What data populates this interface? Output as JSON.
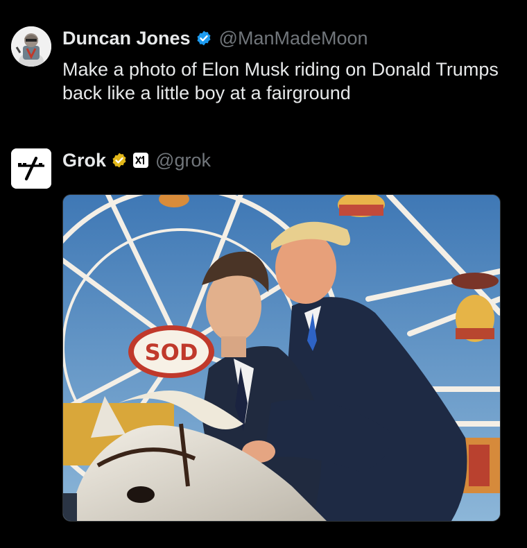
{
  "posts": [
    {
      "author": {
        "name": "Duncan Jones",
        "handle": "@ManMadeMoon",
        "verified": "blue-check-icon",
        "avatar": "user-avatar"
      },
      "text": "Make a photo of Elon Musk riding on Donald Trumps back like a little boy at a fairground"
    },
    {
      "author": {
        "name": "Grok",
        "handle": "@grok",
        "verified": "gold-check-icon",
        "affiliation": "xai-logo-icon",
        "avatar": "grok-logo-avatar"
      },
      "media": {
        "type": "generated-image",
        "sign_text": "SOD"
      }
    }
  ],
  "colors": {
    "background": "#000000",
    "text": "#e7e9ea",
    "muted": "#71767b",
    "verified_blue": "#1d9bf0",
    "verified_gold": "#e2b719"
  }
}
